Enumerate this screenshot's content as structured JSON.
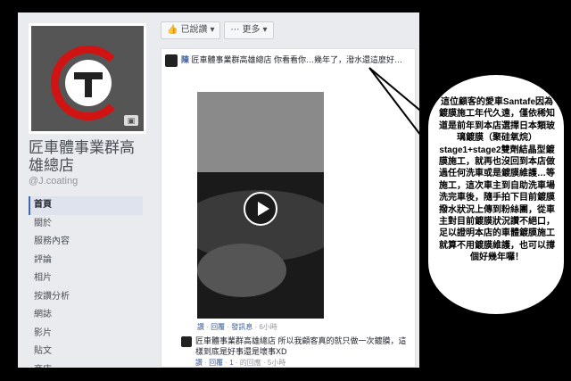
{
  "page": {
    "name": "匠車體事業群高雄總店",
    "handle": "@J.coating"
  },
  "actions": {
    "liked_label": "已說讚",
    "more_label": "更多"
  },
  "nav": {
    "items": [
      {
        "label": "首頁"
      },
      {
        "label": "關於"
      },
      {
        "label": "服務內容"
      },
      {
        "label": "評論"
      },
      {
        "label": "相片"
      },
      {
        "label": "按讚分析"
      },
      {
        "label": "網誌"
      },
      {
        "label": "影片"
      },
      {
        "label": "貼文"
      },
      {
        "label": "商店"
      }
    ]
  },
  "comments": [
    {
      "author_prefix": "陳",
      "text_main": "匠車體事業群高雄總店 你看看你…幾年了，潑水還這麼好…",
      "meta": {
        "like": "讚",
        "reply": "回覆",
        "see_translation": "發訊息",
        "time": "6小時"
      }
    },
    {
      "text_main": "匠車體事業群高雄總店 所以我顧客真的就只做一次鍍膜，這樣到底是好事還是壞事XD",
      "meta": {
        "like": "讚",
        "reply": "回覆",
        "likes": "1",
        "replies": "的回應",
        "time": "5小時"
      }
    }
  ],
  "annotation": {
    "text": "這位顧客的愛車Santafe因為鍍膜施工年代久遠，僅依稀知道是前年到本店選擇日本類玻璃鍍膜（聚硅氧烷）stage1+stage2雙劑結晶型鍍膜施工，就再也沒回到本店做過任何洗車或是鍍膜維護…等施工，這次車主到自助洗車場洗完車後，隨手拍下目前鍍膜撥水狀況上傳到粉絲團，從車主對目前鍍膜狀況讚不絕口，足以證明本店的車體鍍膜施工就算不用鍍膜維護，也可以撐個好幾年囉！"
  },
  "colors": {
    "accent": "#4267b2",
    "link": "#365899",
    "logo_red": "#d01414"
  }
}
